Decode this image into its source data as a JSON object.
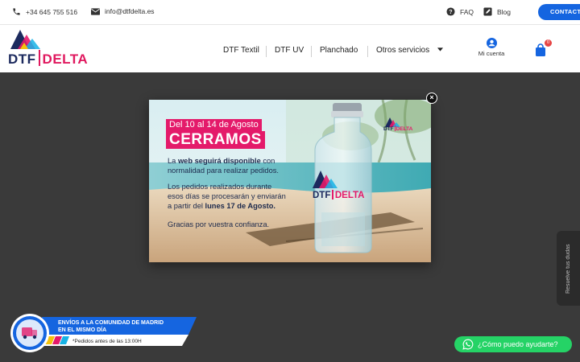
{
  "topbar": {
    "phone": "+34 645 755 516",
    "email": "info@dtfdelta.es",
    "faq": "FAQ",
    "blog": "Blog",
    "contact": "CONTACT"
  },
  "header": {
    "logo_dtf": "DTF",
    "logo_delta": "DELTA",
    "nav": [
      "DTF Textil",
      "DTF UV",
      "Planchado",
      "Otros servicios"
    ],
    "account": "Mi cuenta",
    "cart_count": "0"
  },
  "popup": {
    "dates": "Del 10 al 14 de Agosto",
    "closed": "CERRAMOS",
    "p1_pre": "La ",
    "p1_bold": "web seguirá disponible",
    "p1_post": " con",
    "p1_line2": "normalidad para realizar pedidos.",
    "p2_line1": "Los pedidos realizados durante",
    "p2_line2": "esos días se procesarán y enviarán",
    "p2_pre": "a partir del ",
    "p2_bold": "lunes 17 de Agosto.",
    "p3": "Gracias por vuestra confianza.",
    "bottle_logo_dtf": "DTF",
    "bottle_logo_delta": "DELTA",
    "close": "×"
  },
  "promo": {
    "line1a": "ENVÍOS A LA COMUNIDAD DE MADRID",
    "line1b": "EN EL MISMO DÍA",
    "line2": "*Pedidos antes de las 13:00H"
  },
  "side_tab": "Resuelve tus dudas",
  "whatsapp": "¿Cómo puedo ayudarte?",
  "colors": {
    "accent_blue": "#1565e0",
    "brand_pink": "#e41a6a",
    "brand_navy": "#1c2a5e",
    "whatsapp": "#25d366"
  }
}
